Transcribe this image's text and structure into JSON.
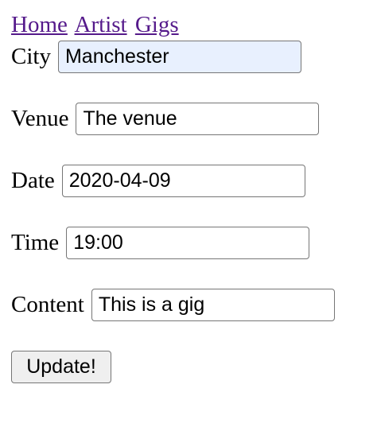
{
  "nav": {
    "links": [
      "Home",
      "Artist",
      "Gigs"
    ]
  },
  "form": {
    "fields": [
      {
        "label": "City",
        "value": "Manchester"
      },
      {
        "label": "Venue",
        "value": "The venue"
      },
      {
        "label": "Date",
        "value": "2020-04-09"
      },
      {
        "label": "Time",
        "value": "19:00"
      },
      {
        "label": "Content",
        "value": "This is a gig"
      }
    ],
    "submit_label": "Update!"
  },
  "colors": {
    "link": "#551a8b",
    "autofill_background": "#e8f0fe",
    "button_background": "#efefef",
    "input_border": "#767676"
  }
}
